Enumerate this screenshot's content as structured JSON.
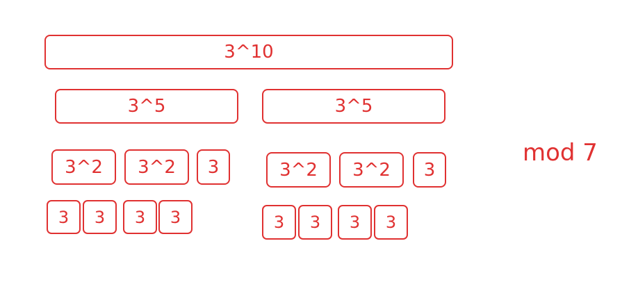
{
  "diagram": {
    "top": "3^10",
    "level2": [
      "3^5",
      "3^5"
    ],
    "level3_left": [
      "3^2",
      "3^2",
      "3"
    ],
    "level3_right": [
      "3^2",
      "3^2",
      "3"
    ],
    "level4_left": [
      "3",
      "3",
      "3",
      "3"
    ],
    "level4_right": [
      "3",
      "3",
      "3",
      "3"
    ],
    "modulus_label": "mod 7"
  },
  "colors": {
    "stroke": "#e03131",
    "background": "#ffffff"
  }
}
